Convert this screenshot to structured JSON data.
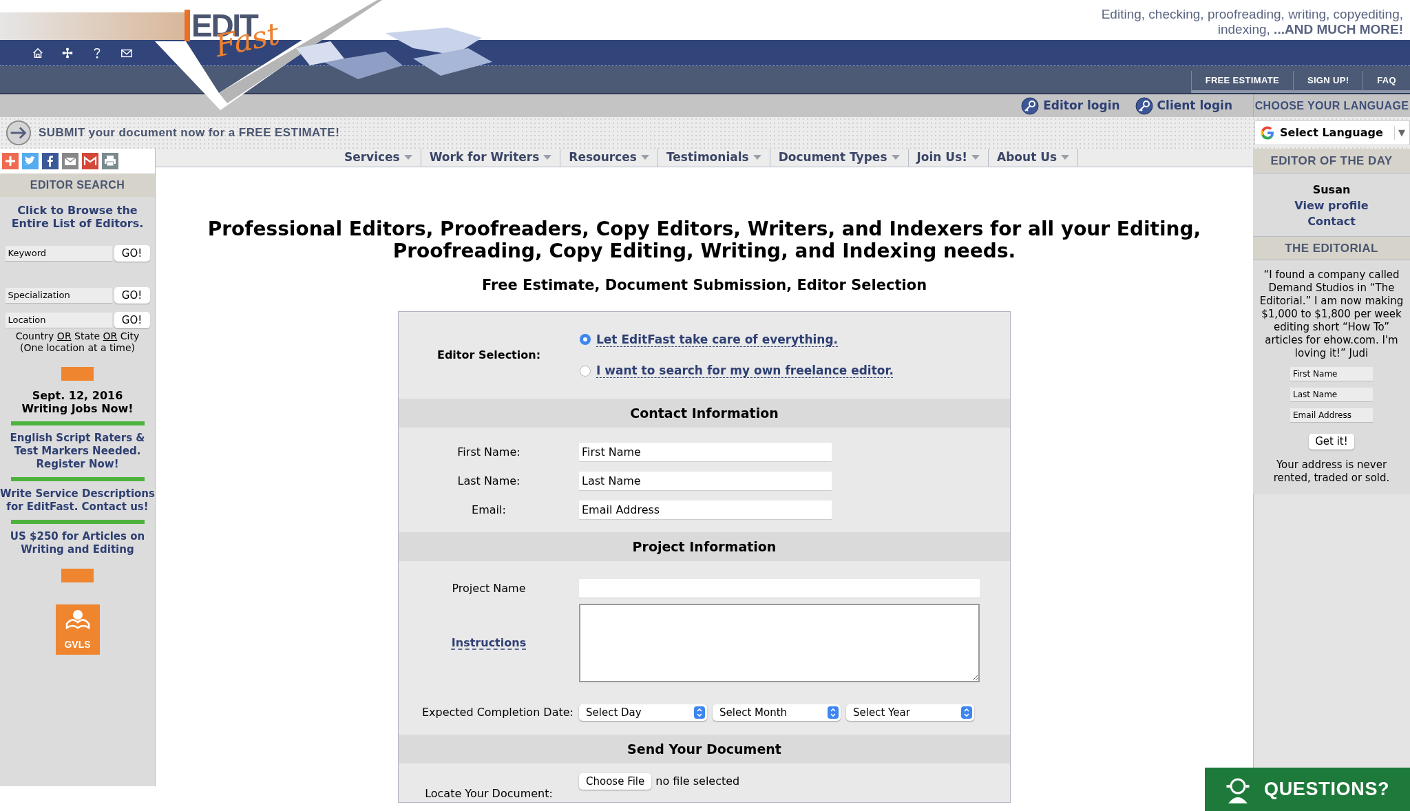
{
  "header": {
    "logo_word_1": "EDIT",
    "logo_word_2": "Fast",
    "tagline": [
      "Editing, checking, proofreading, writing, copyediting,",
      "indexing, **...AND MUCH MORE!**"
    ],
    "top_tabs": [
      "FREE ESTIMATE",
      "SIGN UP!",
      "FAQ"
    ],
    "logins": [
      "Editor login",
      "Client login"
    ],
    "language_title": "CHOOSE YOUR LANGUAGE",
    "banner": "**SUBMIT** your document now for a **FREE ESTIMATE**!",
    "language_select": "Select Language",
    "language_select_caret": "▼"
  },
  "nav": [
    "Services",
    "Work for Writers",
    "Resources",
    "Testimonials",
    "Document Types",
    "Join Us!",
    "About Us"
  ],
  "left_sidebar": {
    "title": "EDITOR SEARCH",
    "browse_link": "Click to Browse the Entire List of Editors.",
    "search_fields": [
      {
        "placeholder": "Keyword",
        "button": "GO!"
      },
      {
        "placeholder": "Specialization",
        "button": "GO!"
      },
      {
        "placeholder": "Location",
        "button": "GO!"
      }
    ],
    "location_hint": [
      {
        "text": "Country ",
        "underline": false
      },
      {
        "text": "OR",
        "underline": true
      },
      {
        "text": " State ",
        "underline": false
      },
      {
        "text": "OR",
        "underline": true
      },
      {
        "text": " City",
        "underline": false
      }
    ],
    "location_hint_2": "(One location at a time)",
    "date": "Sept. 12, 2016",
    "date_headline": "Writing Jobs Now!",
    "announcements": [
      "English Script Raters & Test Markers Needed. Register Now!",
      "Write Service Descriptions for EditFast. Contact us!",
      "US $250 for Articles on Writing and Editing"
    ],
    "badge_text": "GVLS"
  },
  "right_sidebar": {
    "editor_title": "EDITOR OF THE DAY",
    "editor_name": "Susan",
    "links": [
      "View profile",
      "Contact"
    ],
    "editorial_title": "THE EDITORIAL",
    "quote": "“I found a company called Demand Studios in “The Editorial.” I am now making $1,000 to $1,800 per week editing short “How To” articles for ehow.com. I'm loving it!” Judi",
    "fields": [
      {
        "placeholder": "First Name"
      },
      {
        "placeholder": "Last Name"
      },
      {
        "placeholder": "Email Address"
      }
    ],
    "button": "Get it!",
    "note": "Your address is never rented, traded or sold."
  },
  "main": {
    "heading": "Professional Editors, Proofreaders, Copy Editors, Writers, and Indexers for all your Editing, Proofreading, Copy Editing, Writing, and Indexing needs.",
    "subheading": "Free Estimate, Document Submission, Editor Selection",
    "editor_selection": {
      "label": "Editor Selection:",
      "options": [
        {
          "label": "Let EditFast take care of everything.",
          "selected": true
        },
        {
          "label": "I want to search for my own freelance editor.",
          "selected": false
        }
      ]
    },
    "contact": {
      "title": "Contact Information",
      "fields": [
        {
          "label": "First Name:",
          "placeholder": "First Name"
        },
        {
          "label": "Last Name:",
          "placeholder": "Last Name"
        },
        {
          "label": "Email:",
          "placeholder": "Email Address"
        }
      ]
    },
    "project": {
      "title": "Project Information",
      "name_label": "Project Name",
      "instructions_label": "Instructions",
      "date_label": "Expected Completion Date:",
      "date_selects": [
        "Select Day",
        "Select Month",
        "Select Year"
      ]
    },
    "send": {
      "title": "Send Your Document",
      "locate_label": "Locate Your Document:",
      "file_button": "Choose File",
      "file_status": "no file selected"
    }
  },
  "questions_button": "QUESTIONS?"
}
